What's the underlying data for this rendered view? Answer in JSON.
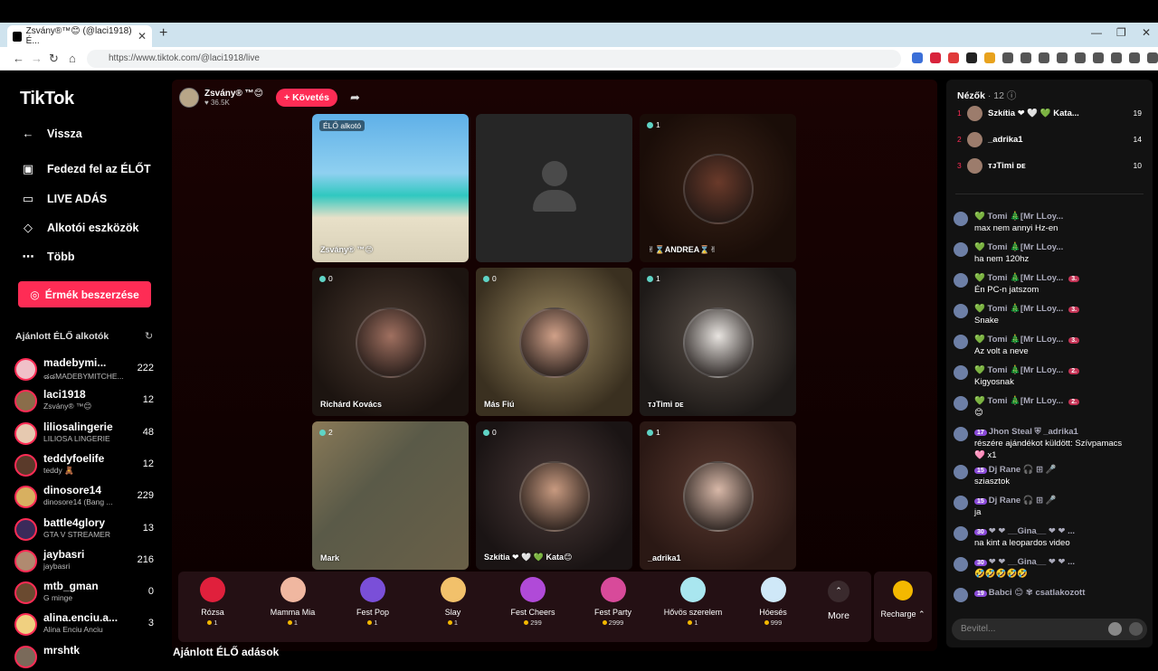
{
  "browser": {
    "tab_title": "Zsvány®™😊 (@laci1918) É...",
    "url": "https://www.tiktok.com/@laci1918/live"
  },
  "sidebar": {
    "logo": "TikTok",
    "back": "Vissza",
    "nav": [
      "Fedezd fel az ÉLŐT",
      "LIVE ADÁS",
      "Alkotói eszközök",
      "Több"
    ],
    "coins_button": "Érmék beszerzése",
    "recommended_title": "Ajánlott ÉLŐ alkotók",
    "creators": [
      {
        "name": "madebymi...",
        "sub": "๘๘MADEBYMITCHE...",
        "count": "222"
      },
      {
        "name": "laci1918",
        "sub": "Zsvány® ™😊",
        "count": "12"
      },
      {
        "name": "liliosalingerie",
        "sub": "LILIOSA LINGERIE",
        "count": "48"
      },
      {
        "name": "teddyfoelife",
        "sub": "teddy 🧸",
        "count": "12"
      },
      {
        "name": "dinosore14",
        "sub": "dinosore14 (Bang ...",
        "count": "229"
      },
      {
        "name": "battle4glory",
        "sub": "GTA V STREAMER",
        "count": "13"
      },
      {
        "name": "jaybasri",
        "sub": "jaybasri",
        "count": "216"
      },
      {
        "name": "mtb_gman",
        "sub": "G minge",
        "count": "0"
      },
      {
        "name": "alina.enciu.a...",
        "sub": "Alina Enciu Anciu",
        "count": "3"
      },
      {
        "name": "mrshtk",
        "sub": "",
        "count": ""
      }
    ]
  },
  "host": {
    "name": "Zsvány",
    "suffix": "® ™😊",
    "likes": "♥ 36.5K",
    "follow": "+ Követés"
  },
  "tiles": [
    {
      "badge": "ÉLŐ alkotó",
      "label": "Zsvány® ™😊"
    },
    {
      "badge": "",
      "label": ""
    },
    {
      "badge": "1",
      "label": "✌⌛ANDREA⌛✌"
    },
    {
      "badge": "0",
      "label": "Richárd Kovács"
    },
    {
      "badge": "0",
      "label": "Más Fiú"
    },
    {
      "badge": "1",
      "label": "ᴛᴊTimi ᴅᴇ"
    },
    {
      "badge": "2",
      "label": "Mark"
    },
    {
      "badge": "0",
      "label": "Szkítia ❤ 🤍 💚 Kata😊"
    },
    {
      "badge": "1",
      "label": "_adrika1"
    }
  ],
  "gifts": [
    {
      "name": "Rózsa",
      "price": "1",
      "color": "#e0203c"
    },
    {
      "name": "Mamma Mia",
      "price": "1",
      "color": "#f0b7a0"
    },
    {
      "name": "Fest Pop",
      "price": "1",
      "color": "#7a4fd8"
    },
    {
      "name": "Slay",
      "price": "1",
      "color": "#f2c16b"
    },
    {
      "name": "Fest Cheers",
      "price": "299",
      "color": "#b04ad8"
    },
    {
      "name": "Fest Party",
      "price": "2999",
      "color": "#d84a9a"
    },
    {
      "name": "Hővös szerelem",
      "price": "1",
      "color": "#a9e6ef"
    },
    {
      "name": "Hóesés",
      "price": "999",
      "color": "#cfe8f8"
    }
  ],
  "more_label": "More",
  "recharge_label": "Recharge ⌃",
  "bottom_title": "Ajánlott ÉLŐ adások",
  "chat": {
    "viewers_title": "Nézők",
    "viewers_count": "· 12 ⓘ",
    "top_viewers": [
      {
        "rank": "1",
        "name": "Szkítia ❤ 🤍 💚 Kata...",
        "score": "19"
      },
      {
        "rank": "2",
        "name": "_adrika1",
        "score": "14"
      },
      {
        "rank": "3",
        "name": "ᴛᴊTimi ᴅᴇ",
        "score": "10"
      }
    ],
    "messages": [
      {
        "user": "💚 Tomi 🎄[Mr LLoy...",
        "text": "max nem annyi Hz-en",
        "tag": ""
      },
      {
        "user": "💚 Tomi 🎄[Mr LLoy...",
        "text": "ha nem 120hz",
        "tag": ""
      },
      {
        "user": "💚 Tomi 🎄[Mr LLoy...",
        "text": "Én PC-n jatszom",
        "tag": "3."
      },
      {
        "user": "💚 Tomi 🎄[Mr LLoy...",
        "text": "Snake",
        "tag": "3."
      },
      {
        "user": "💚 Tomi 🎄[Mr LLoy...",
        "text": "Az volt a neve",
        "tag": "3."
      },
      {
        "user": "💚 Tomi 🎄[Mr LLoy...",
        "text": "Kigyosnak",
        "tag": "2."
      },
      {
        "user": "💚 Tomi 🎄[Mr LLoy...",
        "text": "😊",
        "tag": "2."
      },
      {
        "user": "Jhon Steal ⛨ _adrika1",
        "text": "részére ajándékot küldött: Szívpamacs",
        "text2": "🩷 x1",
        "level": "17"
      },
      {
        "user": "Dj Rane 🎧 ⊞ 🎤",
        "text": "sziasztok",
        "level": "15"
      },
      {
        "user": "Dj Rane 🎧 ⊞ 🎤",
        "text": "ja",
        "level": "15"
      },
      {
        "user": "❤ ❤ __Gina__ ❤ ❤ ...",
        "text": "na kint a leopardos video",
        "level": "30"
      },
      {
        "user": "❤ ❤ __Gina__ ❤ ❤ ...",
        "text": "🤣🤣🤣🤣🤣",
        "level": "30"
      },
      {
        "user": "Babci 😊 ✾  csatlakozott",
        "text": "",
        "level": "19"
      }
    ],
    "input_placeholder": "Bevitel..."
  }
}
